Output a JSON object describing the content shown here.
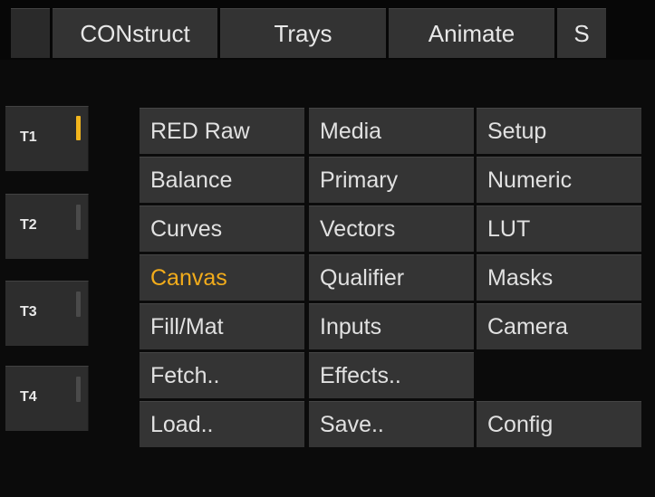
{
  "top_tabs": [
    {
      "id": "stub",
      "label": ""
    },
    {
      "id": "construct",
      "label": "CONstruct"
    },
    {
      "id": "trays",
      "label": "Trays"
    },
    {
      "id": "animate",
      "label": "Animate"
    },
    {
      "id": "s",
      "label": "S"
    }
  ],
  "side_trays": [
    {
      "label": "T1",
      "active": true
    },
    {
      "label": "T2",
      "active": false
    },
    {
      "label": "T3",
      "active": false
    },
    {
      "label": "T4",
      "active": false
    }
  ],
  "grid": {
    "rows": [
      [
        "RED Raw",
        "Media",
        "Setup"
      ],
      [
        "Balance",
        "Primary",
        "Numeric"
      ],
      [
        "Curves",
        "Vectors",
        "LUT"
      ],
      [
        "Canvas",
        "Qualifier",
        "Masks"
      ],
      [
        "Fill/Mat",
        "Inputs",
        "Camera"
      ],
      [
        "Fetch..",
        "Effects..",
        ""
      ],
      [
        "Load..",
        "Save..",
        "Config"
      ]
    ],
    "active_item": "Canvas"
  },
  "colors": {
    "background": "#0b0b0b",
    "panel": "#343434",
    "text": "#e1e1e1",
    "accent": "#f2ac1b"
  }
}
